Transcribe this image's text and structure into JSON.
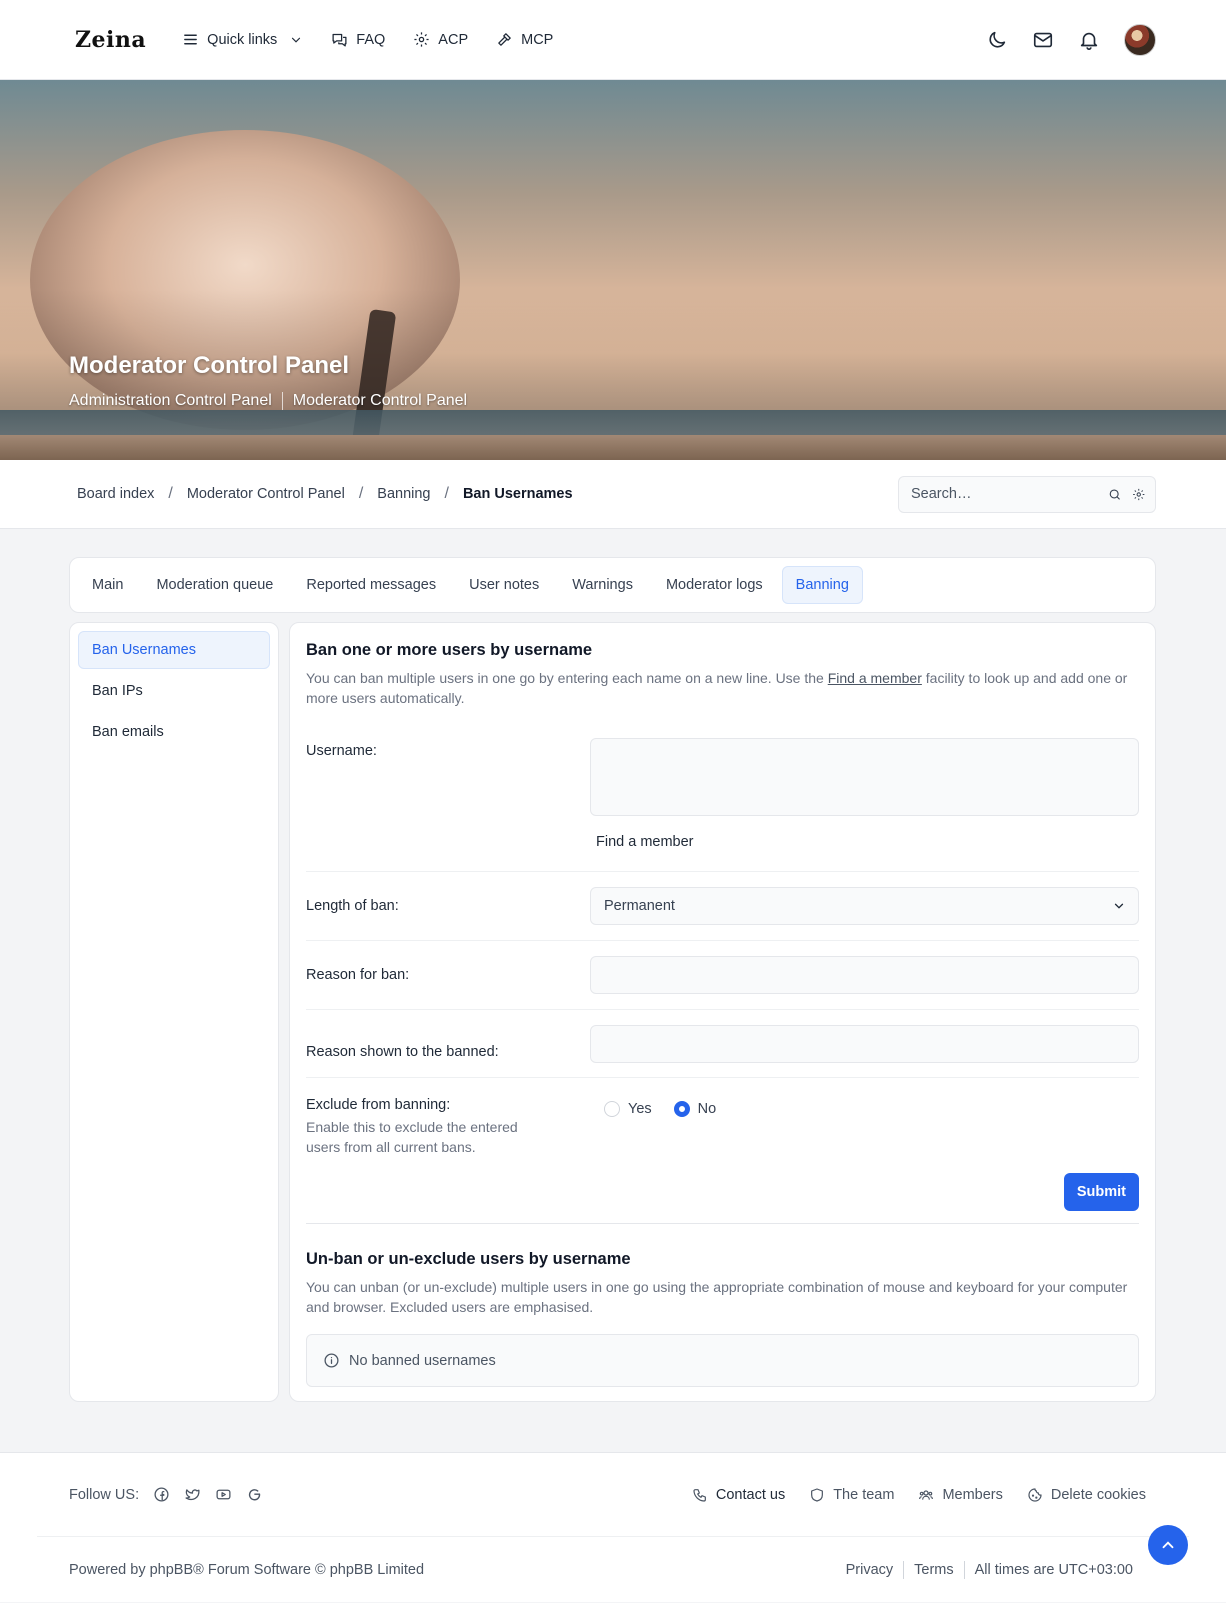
{
  "header": {
    "logo": "Zeina",
    "nav": [
      {
        "label": "Quick links",
        "icon": "menu-icon"
      },
      {
        "label": "FAQ",
        "icon": "faq-icon"
      },
      {
        "label": "ACP",
        "icon": "gear-icon"
      },
      {
        "label": "MCP",
        "icon": "hammer-icon"
      }
    ],
    "icons": [
      "moon-icon",
      "mail-icon",
      "bell-icon",
      "avatar"
    ]
  },
  "hero": {
    "title": "Moderator Control Panel",
    "links": [
      "Administration Control Panel",
      "Moderator Control Panel"
    ]
  },
  "breadcrumb": [
    "Board index",
    "Moderator Control Panel",
    "Banning",
    "Ban Usernames"
  ],
  "search": {
    "placeholder": "Search…"
  },
  "tabs": [
    "Main",
    "Moderation queue",
    "Reported messages",
    "User notes",
    "Warnings",
    "Moderator logs",
    "Banning"
  ],
  "active_tab": "Banning",
  "sidebar": [
    "Ban Usernames",
    "Ban IPs",
    "Ban emails"
  ],
  "active_sidebar": "Ban Usernames",
  "ban_section": {
    "title": "Ban one or more users by username",
    "desc_before": "You can ban multiple users in one go by entering each name on a new line. Use the ",
    "desc_link": "Find a member",
    "desc_after": " facility to look up and add one or more users automatically.",
    "username_label": "Username:",
    "username_value": "",
    "find_member": "Find a member",
    "length_label": "Length of ban:",
    "length_value": "Permanent",
    "reason_label": "Reason for ban:",
    "reason_value": "",
    "reason_shown_label": "Reason shown to the banned:",
    "reason_shown_value": "",
    "exclude_label": "Exclude from banning:",
    "exclude_hint": "Enable this to exclude the entered users from all current bans.",
    "exclude_options": [
      "Yes",
      "No"
    ],
    "exclude_selected": "No",
    "submit": "Submit"
  },
  "unban_section": {
    "title": "Un-ban or un-exclude users by username",
    "desc": "You can unban (or un-exclude) multiple users in one go using the appropriate combination of mouse and keyboard for your computer and browser. Excluded users are emphasised.",
    "notice": "No banned usernames"
  },
  "footer": {
    "follow_label": "Follow US:",
    "social_icons": [
      "facebook-icon",
      "twitter-icon",
      "youtube-icon",
      "google-icon"
    ],
    "links": [
      "Contact us",
      "The team",
      "Members",
      "Delete cookies"
    ],
    "powered": "Powered by phpBB® Forum Software © phpBB Limited",
    "legal": [
      "Privacy",
      "Terms",
      "All times are UTC+03:00"
    ]
  },
  "colors": {
    "accent": "#2563eb",
    "active_bg": "#eef4fd"
  }
}
